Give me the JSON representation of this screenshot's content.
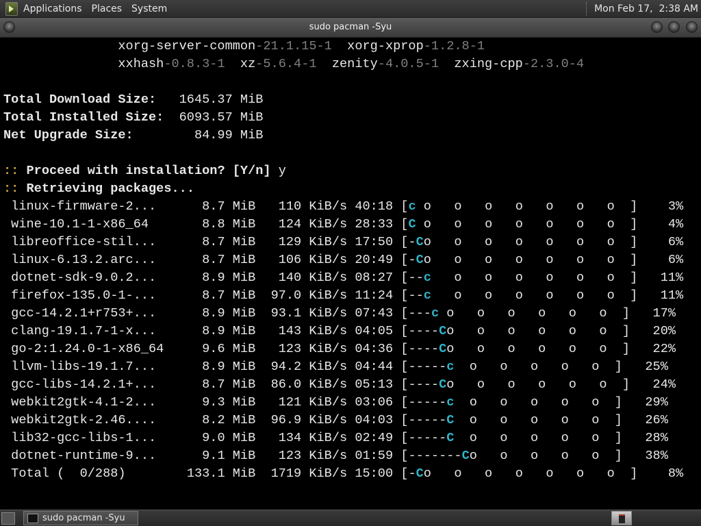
{
  "panel": {
    "menus": [
      "Applications",
      "Places",
      "System"
    ],
    "clock": "Mon Feb 17,  2:38 AM"
  },
  "window": {
    "title": "sudo pacman -Syu"
  },
  "terminal": {
    "pkg_rows": [
      [
        [
          "xorg-server-common",
          "-21.1.15-1"
        ],
        [
          "xorg-xprop",
          "-1.2.8-1"
        ]
      ],
      [
        [
          "xxhash",
          "-0.8.3-1"
        ],
        [
          "xz",
          "-5.6.4-1"
        ],
        [
          "zenity",
          "-4.0.5-1"
        ],
        [
          "zxing-cpp",
          "-2.3.0-4"
        ]
      ]
    ],
    "sizes": [
      {
        "label": "Total Download Size:",
        "value": "1645.37 MiB"
      },
      {
        "label": "Total Installed Size:",
        "value": "6093.57 MiB"
      },
      {
        "label": "Net Upgrade Size:",
        "value": "84.99 MiB"
      }
    ],
    "prompt": {
      "marker": "::",
      "text": "Proceed with installation? [Y/n]",
      "answer": "y"
    },
    "retrieving": {
      "marker": "::",
      "text": "Retrieving packages..."
    },
    "downloads": [
      {
        "name": "linux-firmware-2...",
        "size": "8.7 MiB",
        "rate": "110 KiB/s",
        "eta": "40:18",
        "bar": "[",
        "pac": "c",
        "dots": " o   o   o   o   o   o   o  ]",
        "pct": "3%"
      },
      {
        "name": "wine-10.1-1-x86_64",
        "size": "8.8 MiB",
        "rate": "124 KiB/s",
        "eta": "28:33",
        "bar": "[",
        "pac": "C",
        "dots": " o   o   o   o   o   o   o  ]",
        "pct": "4%"
      },
      {
        "name": "libreoffice-stil...",
        "size": "8.7 MiB",
        "rate": "129 KiB/s",
        "eta": "17:50",
        "bar": "[-",
        "pac": "C",
        "dots": "o   o   o   o   o   o   o  ]",
        "pct": "6%"
      },
      {
        "name": "linux-6.13.2.arc...",
        "size": "8.7 MiB",
        "rate": "106 KiB/s",
        "eta": "20:49",
        "bar": "[-",
        "pac": "C",
        "dots": "o   o   o   o   o   o   o  ]",
        "pct": "6%"
      },
      {
        "name": "dotnet-sdk-9.0.2...",
        "size": "8.9 MiB",
        "rate": "140 KiB/s",
        "eta": "08:27",
        "bar": "[--",
        "pac": "c",
        "dots": "   o   o   o   o   o   o  ]",
        "pct": "11%"
      },
      {
        "name": "firefox-135.0-1-...",
        "size": "8.7 MiB",
        "rate": "97.0 KiB/s",
        "eta": "11:24",
        "bar": "[--",
        "pac": "c",
        "dots": "   o   o   o   o   o   o  ]",
        "pct": "11%"
      },
      {
        "name": "gcc-14.2.1+r753+...",
        "size": "8.9 MiB",
        "rate": "93.1 KiB/s",
        "eta": "07:43",
        "bar": "[---",
        "pac": "c",
        "dots": " o   o   o   o   o   o  ]",
        "pct": "17%"
      },
      {
        "name": "clang-19.1.7-1-x...",
        "size": "8.9 MiB",
        "rate": "143 KiB/s",
        "eta": "04:05",
        "bar": "[----",
        "pac": "C",
        "dots": "o   o   o   o   o   o  ]",
        "pct": "20%"
      },
      {
        "name": "go-2:1.24.0-1-x86_64",
        "size": "9.6 MiB",
        "rate": "123 KiB/s",
        "eta": "04:36",
        "bar": "[----",
        "pac": "C",
        "dots": "o   o   o   o   o   o  ]",
        "pct": "22%"
      },
      {
        "name": "llvm-libs-19.1.7...",
        "size": "8.9 MiB",
        "rate": "94.2 KiB/s",
        "eta": "04:44",
        "bar": "[-----",
        "pac": "c",
        "dots": "  o   o   o   o   o  ]",
        "pct": "25%"
      },
      {
        "name": "gcc-libs-14.2.1+...",
        "size": "8.7 MiB",
        "rate": "86.0 KiB/s",
        "eta": "05:13",
        "bar": "[----",
        "pac": "C",
        "dots": "o   o   o   o   o   o  ]",
        "pct": "24%"
      },
      {
        "name": "webkit2gtk-4.1-2...",
        "size": "9.3 MiB",
        "rate": "121 KiB/s",
        "eta": "03:06",
        "bar": "[-----",
        "pac": "c",
        "dots": "  o   o   o   o   o  ]",
        "pct": "29%"
      },
      {
        "name": "webkit2gtk-2.46....",
        "size": "8.2 MiB",
        "rate": "96.9 KiB/s",
        "eta": "04:03",
        "bar": "[-----",
        "pac": "C",
        "dots": "  o   o   o   o   o  ]",
        "pct": "26%"
      },
      {
        "name": "lib32-gcc-libs-1...",
        "size": "9.0 MiB",
        "rate": "134 KiB/s",
        "eta": "02:49",
        "bar": "[-----",
        "pac": "C",
        "dots": "  o   o   o   o   o  ]",
        "pct": "28%"
      },
      {
        "name": "dotnet-runtime-9...",
        "size": "9.1 MiB",
        "rate": "123 KiB/s",
        "eta": "01:59",
        "bar": "[-------",
        "pac": "C",
        "dots": "o   o   o   o   o  ]",
        "pct": "38%"
      }
    ],
    "total": {
      "name": "Total (  0/288)",
      "size": "133.1 MiB",
      "rate": "1719 KiB/s",
      "eta": "15:00",
      "bar": "[-",
      "pac": "C",
      "dots": "o   o   o   o   o   o   o  ]",
      "pct": "8%"
    }
  },
  "taskbar": {
    "task_label": "sudo pacman -Syu"
  },
  "colors": {
    "accent_cyan": "#2fb4c8",
    "marker_gold": "#c8a24a",
    "dim_gray": "#808080"
  }
}
